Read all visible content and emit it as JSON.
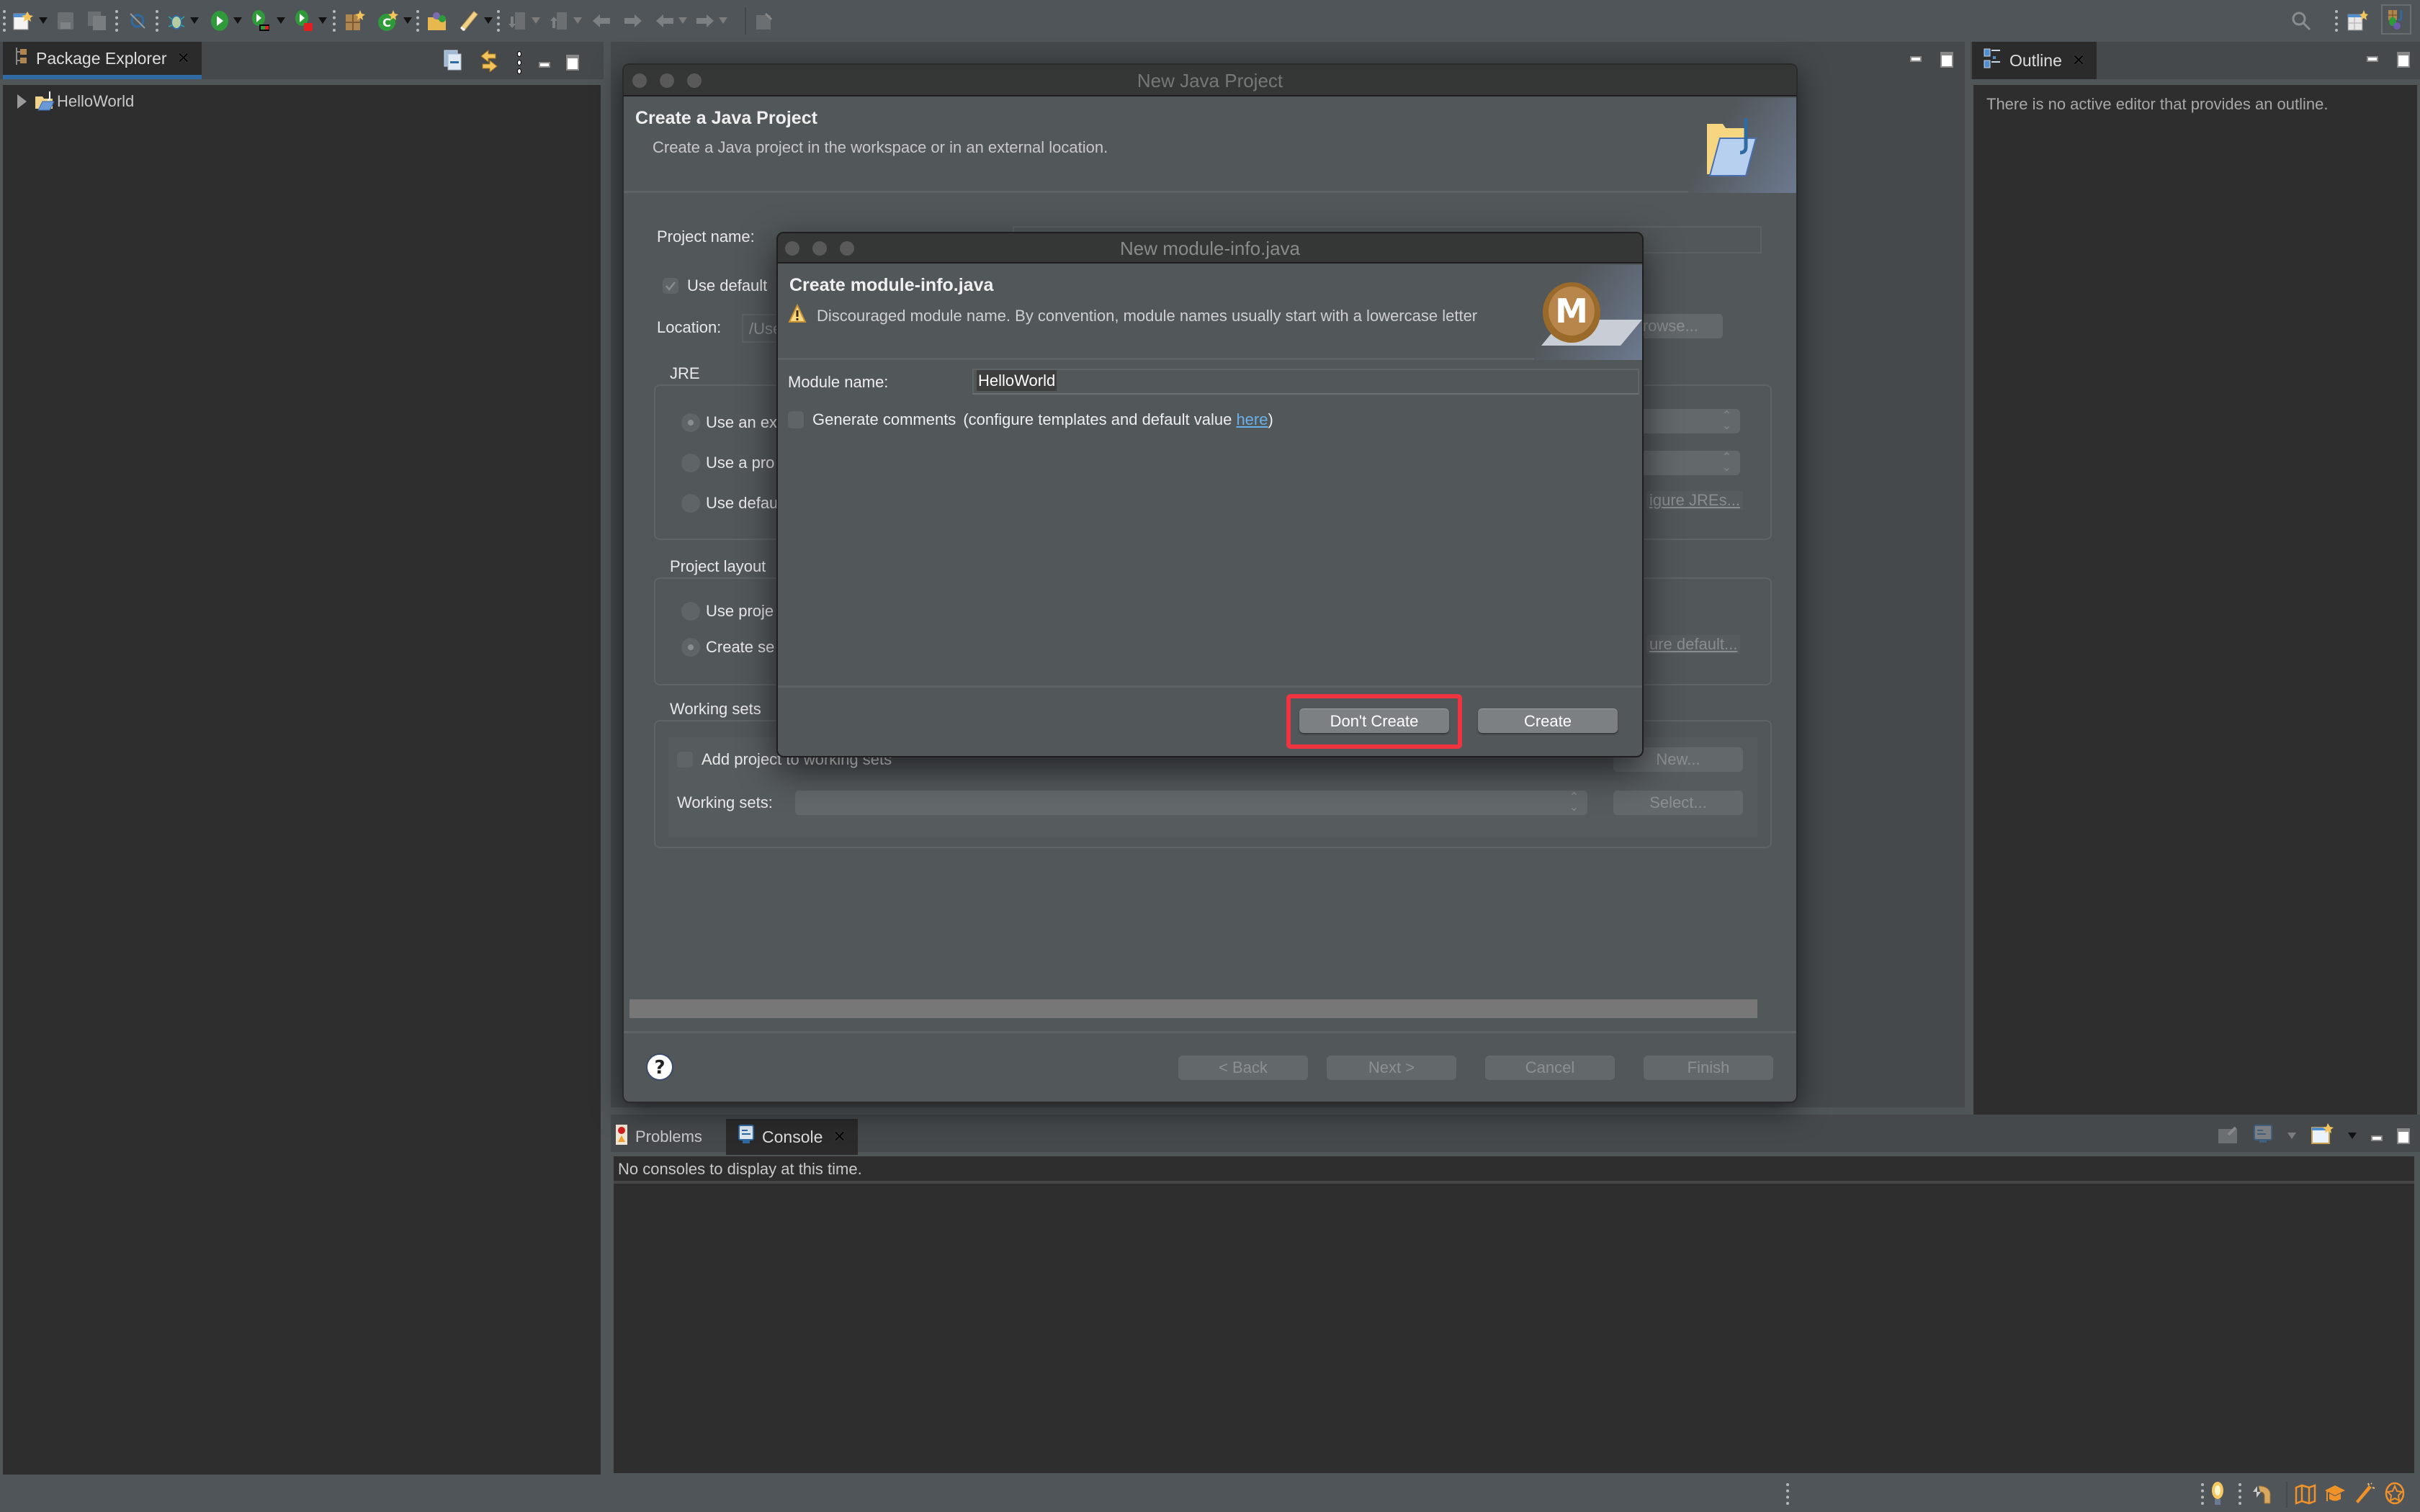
{
  "toolbar": {
    "items": [
      {
        "icon": "new-file-icon",
        "has_dropdown": true,
        "enabled": true
      },
      {
        "icon": "save-icon",
        "has_dropdown": false,
        "enabled": false
      },
      {
        "icon": "save-all-icon",
        "has_dropdown": false,
        "enabled": false
      },
      {
        "icon": "open-type-icon",
        "has_dropdown": false,
        "enabled": true
      },
      {
        "icon": "debug-icon",
        "has_dropdown": true,
        "enabled": true
      },
      {
        "icon": "run-icon",
        "has_dropdown": true,
        "enabled": true
      },
      {
        "icon": "coverage-icon",
        "has_dropdown": true,
        "enabled": true
      },
      {
        "icon": "external-tools-icon",
        "has_dropdown": true,
        "enabled": true
      },
      {
        "icon": "new-java-package-icon",
        "has_dropdown": false,
        "enabled": true
      },
      {
        "icon": "new-java-class-icon",
        "has_dropdown": true,
        "enabled": true
      },
      {
        "icon": "open-folder-icon",
        "has_dropdown": false,
        "enabled": true
      },
      {
        "icon": "pen-annotation-icon",
        "has_dropdown": true,
        "enabled": true
      },
      {
        "icon": "next-annotation-icon",
        "has_dropdown": true,
        "enabled": false
      },
      {
        "icon": "previous-annotation-icon",
        "has_dropdown": true,
        "enabled": false
      },
      {
        "icon": "last-edit-location-icon",
        "has_dropdown": false,
        "enabled": false
      },
      {
        "icon": "forward-edit-icon",
        "has_dropdown": false,
        "enabled": false
      },
      {
        "icon": "back-icon",
        "has_dropdown": true,
        "enabled": false
      },
      {
        "icon": "forward-icon",
        "has_dropdown": true,
        "enabled": false
      },
      {
        "icon": "pin-editor-icon",
        "has_dropdown": false,
        "enabled": false
      }
    ],
    "right": [
      {
        "icon": "search-icon"
      },
      {
        "icon": "open-perspective-icon"
      },
      {
        "icon": "java-perspective-icon"
      }
    ]
  },
  "package_explorer": {
    "tab_label": "Package Explorer",
    "tree": [
      {
        "label": "HelloWorld",
        "expanded": false
      }
    ]
  },
  "outline": {
    "tab_label": "Outline",
    "message": "There is no active editor that provides an outline."
  },
  "bottom_panel": {
    "tabs": [
      {
        "label": "Problems",
        "active": false
      },
      {
        "label": "Console",
        "active": true
      }
    ],
    "message": "No consoles to display at this time."
  },
  "new_java_project": {
    "window_title": "New Java Project",
    "banner_title": "Create a Java Project",
    "banner_desc": "Create a Java project in the workspace or in an external location.",
    "project_name_label": "Project name:",
    "use_default_label": "Use default",
    "location_label": "Location:",
    "location_value": "/Use",
    "browse_label": "Browse...",
    "jre_group": "JRE",
    "jre_options": [
      "Use an ex",
      "Use a pro",
      "Use defau"
    ],
    "jre_selected": 0,
    "configure_jres": "igure JREs...",
    "layout_group": "Project layout",
    "layout_options": [
      "Use proje",
      "Create se"
    ],
    "layout_selected": 1,
    "configure_default": "ure default...",
    "working_sets_group": "Working sets",
    "add_to_ws_label": "Add project to working sets",
    "new_label": "New...",
    "working_sets_label": "Working sets:",
    "select_label": "Select...",
    "buttons": {
      "back": "< Back",
      "next": "Next >",
      "cancel": "Cancel",
      "finish": "Finish"
    }
  },
  "module_dialog": {
    "window_title": "New module-info.java",
    "banner_title": "Create module-info.java",
    "warning": "Discouraged module name. By convention, module names usually start with a lowercase letter",
    "module_name_label": "Module name:",
    "module_name_value": "HelloWorld",
    "generate_comments_label": "Generate comments",
    "generate_comments_checked": false,
    "configure_prefix": "(configure templates and default value ",
    "configure_link": "here",
    "configure_suffix": ")",
    "dont_create_label": "Don't Create",
    "create_label": "Create",
    "highlight_color": "#f0343f"
  },
  "status_bar": {
    "icons": [
      "tip-of-day-icon",
      "restore-icon",
      "overview-icon",
      "tutorials-icon",
      "samples-icon",
      "whats-new-icon"
    ]
  }
}
